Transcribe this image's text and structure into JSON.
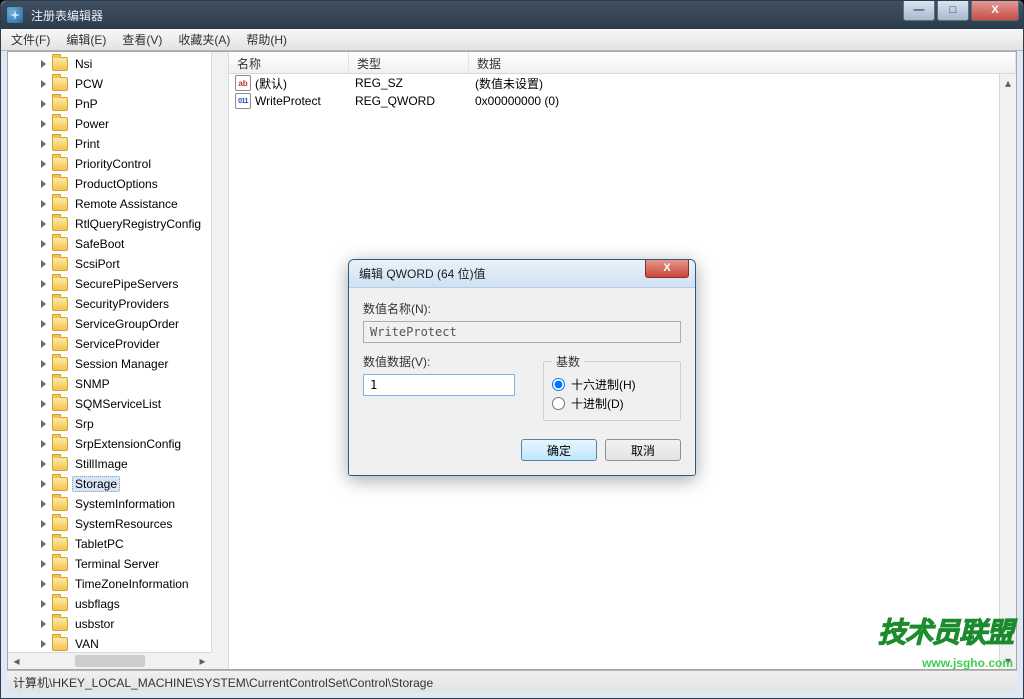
{
  "window": {
    "title": "注册表编辑器"
  },
  "menu": {
    "file": "文件(F)",
    "edit": "编辑(E)",
    "view": "查看(V)",
    "favorites": "收藏夹(A)",
    "help": "帮助(H)"
  },
  "tree": {
    "items": [
      {
        "label": "Nsi"
      },
      {
        "label": "PCW"
      },
      {
        "label": "PnP"
      },
      {
        "label": "Power"
      },
      {
        "label": "Print"
      },
      {
        "label": "PriorityControl"
      },
      {
        "label": "ProductOptions"
      },
      {
        "label": "Remote Assistance"
      },
      {
        "label": "RtlQueryRegistryConfig"
      },
      {
        "label": "SafeBoot"
      },
      {
        "label": "ScsiPort"
      },
      {
        "label": "SecurePipeServers"
      },
      {
        "label": "SecurityProviders"
      },
      {
        "label": "ServiceGroupOrder"
      },
      {
        "label": "ServiceProvider"
      },
      {
        "label": "Session Manager"
      },
      {
        "label": "SNMP"
      },
      {
        "label": "SQMServiceList"
      },
      {
        "label": "Srp"
      },
      {
        "label": "SrpExtensionConfig"
      },
      {
        "label": "StillImage"
      },
      {
        "label": "Storage",
        "selected": true
      },
      {
        "label": "SystemInformation"
      },
      {
        "label": "SystemResources"
      },
      {
        "label": "TabletPC"
      },
      {
        "label": "Terminal Server"
      },
      {
        "label": "TimeZoneInformation"
      },
      {
        "label": "usbflags"
      },
      {
        "label": "usbstor"
      },
      {
        "label": "VAN"
      }
    ]
  },
  "list": {
    "columns": {
      "name": "名称",
      "type": "类型",
      "data": "数据"
    },
    "rows": [
      {
        "icon": "string",
        "name": "(默认)",
        "type": "REG_SZ",
        "data": "(数值未设置)"
      },
      {
        "icon": "binary",
        "name": "WriteProtect",
        "type": "REG_QWORD",
        "data": "0x00000000 (0)"
      }
    ]
  },
  "statusbar": {
    "path": "计算机\\HKEY_LOCAL_MACHINE\\SYSTEM\\CurrentControlSet\\Control\\Storage"
  },
  "dialog": {
    "title": "编辑 QWORD (64 位)值",
    "name_label": "数值名称(N):",
    "name_value": "WriteProtect",
    "data_label": "数值数据(V):",
    "data_value": "1",
    "base_legend": "基数",
    "radio_hex": "十六进制(H)",
    "radio_dec": "十进制(D)",
    "ok": "确定",
    "cancel": "取消"
  },
  "watermark": {
    "chinese": "技术员联盟",
    "url_main": "www.jsgho",
    "url_dot": ".",
    "url_com": "com"
  }
}
